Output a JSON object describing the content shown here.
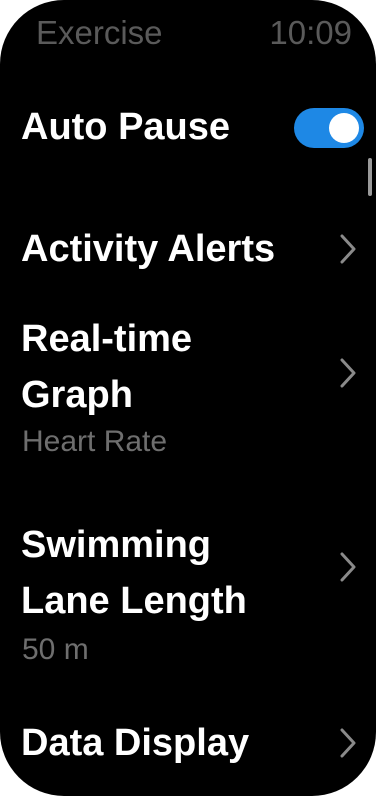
{
  "status_bar": {
    "title": "Exercise",
    "time": "10:09"
  },
  "menu": {
    "items": [
      {
        "label": "Auto Pause",
        "control": "toggle",
        "toggle_on": true
      },
      {
        "label": "Activity Alerts",
        "control": "chevron"
      },
      {
        "label_line1": "Real-time",
        "label_line2": "Graph",
        "value": "Heart Rate",
        "control": "chevron"
      },
      {
        "label_line1": "Swimming",
        "label_line2": "Lane Length",
        "value": "50 m",
        "control": "chevron"
      },
      {
        "label": "Data Display",
        "control": "chevron"
      }
    ]
  },
  "icons": {
    "chevron": "chevron-right-icon"
  },
  "colors": {
    "background": "#000000",
    "status_text": "#5a5a5a",
    "label_text": "#ffffff",
    "value_text": "#6e6e6e",
    "toggle_on": "#1e88e5",
    "chevron": "#8a8a8a"
  }
}
